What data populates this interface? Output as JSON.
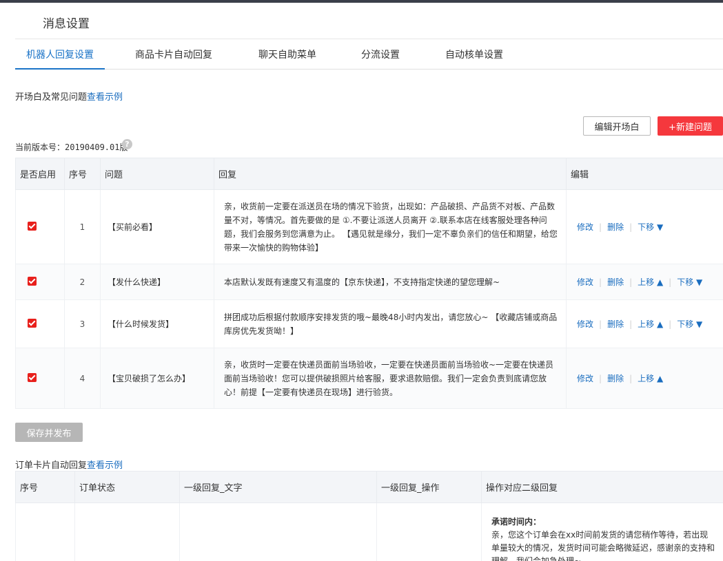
{
  "page_title": "消息设置",
  "tabs": [
    {
      "label": "机器人回复设置",
      "active": true
    },
    {
      "label": "商品卡片自动回复",
      "active": false
    },
    {
      "label": "聊天自助菜单",
      "active": false
    },
    {
      "label": "分流设置",
      "active": false
    },
    {
      "label": "自动核单设置",
      "active": false
    }
  ],
  "faq_section": {
    "label": "开场白及常见问题",
    "example_link": "查看示例"
  },
  "buttons": {
    "edit_opening": "编辑开场白",
    "new_question": "+新建问题",
    "save_publish": "保存并发布"
  },
  "version": {
    "text": "当前版本号：20190409.01版",
    "help": "?"
  },
  "faq_table": {
    "headers": [
      "是否启用",
      "序号",
      "问题",
      "回复",
      "编辑"
    ],
    "rows": [
      {
        "enabled": true,
        "index": "1",
        "question": "【买前必看】",
        "reply": "亲，收货前一定要在派送员在场的情况下验货，出现如：产品破损、产品货不对板、产品数量不对，等情况。首先要做的是 ①.不要让派送人员离开 ②.联系本店在线客服处理各种问题，我们会服务到您满意为止。 【遇见就是缘分，我们一定不辜负亲们的信任和期望，给您带来一次愉快的购物体验】",
        "edit": "修改",
        "delete": "删除",
        "up": "",
        "down": "下移 ▼"
      },
      {
        "enabled": true,
        "index": "2",
        "question": "【发什么快递】",
        "reply": "本店默认发既有速度又有温度的【京东快递】，不支持指定快递的望您理解~",
        "edit": "修改",
        "delete": "删除",
        "up": "上移 ▲",
        "down": "下移 ▼"
      },
      {
        "enabled": true,
        "index": "3",
        "question": "【什么时候发货】",
        "reply": "拼团成功后根据付款顺序安排发货的哦~最晚48小时内发出，请您放心~ 【收藏店铺或商品库房优先发货呦！】",
        "edit": "修改",
        "delete": "删除",
        "up": "上移 ▲",
        "down": "下移 ▼"
      },
      {
        "enabled": true,
        "index": "4",
        "question": "【宝贝破损了怎么办】",
        "reply": "亲，收货时一定要在快递员面前当场验收，一定要在快递员面前当场验收~一定要在快递员面前当场验收！您可以提供破损照片给客服，要求退款赔偿。我们一定会负责到底请您放心！前提【一定要有快递员在现场】进行验货。",
        "edit": "修改",
        "delete": "删除",
        "up": "上移 ▲",
        "down": ""
      }
    ]
  },
  "order_section": {
    "label": "订单卡片自动回复",
    "example_link": "查看示例"
  },
  "order_table": {
    "headers": [
      "序号",
      "订单状态",
      "一级回复_文字",
      "一级回复_操作",
      "操作对应二级回复"
    ],
    "row": {
      "index": "",
      "status": "",
      "reply_text": "",
      "reply_action": "",
      "second_title": "承诺时间内：",
      "second_text": "亲，您这个订单会在xx时间前发货的请您稍作等待，若出现单量较大的情况，发货时间可能会略微延迟，感谢亲的支持和理解，我们会加急处理~"
    }
  },
  "colors": {
    "accent": "#1a73c7",
    "danger": "#f5383d",
    "checkbox": "#e8201c",
    "disabled": "#b6b6b6"
  }
}
